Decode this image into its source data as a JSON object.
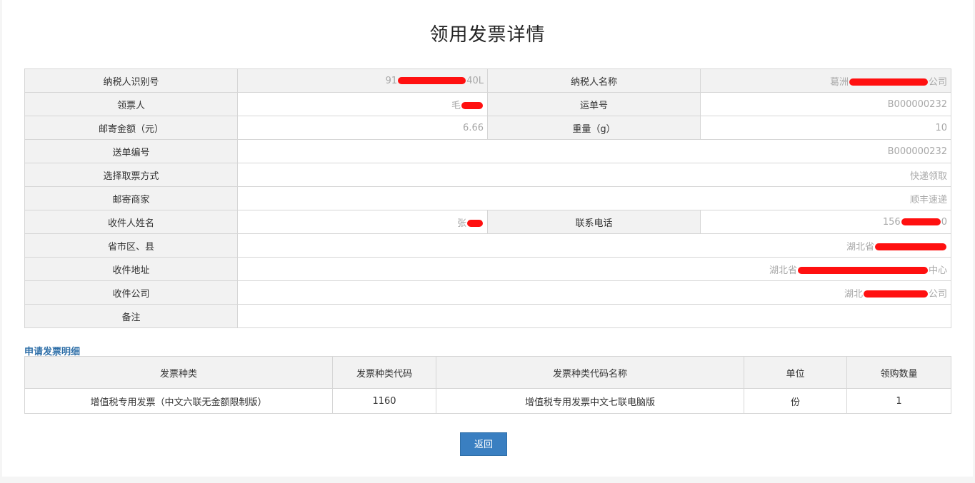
{
  "page": {
    "title": "领用发票详情"
  },
  "detail": {
    "taxpayer_id": {
      "label": "纳税人识别号",
      "value_prefix": "91",
      "value_suffix": "40L"
    },
    "taxpayer_name": {
      "label": "纳税人名称",
      "value_prefix": "葛洲",
      "value_suffix": "公司"
    },
    "recipient": {
      "label": "领票人",
      "value_prefix": "毛",
      "value_suffix": ""
    },
    "waybill_no": {
      "label": "运单号",
      "value": "B000000232"
    },
    "postage": {
      "label": "邮寄金额（元）",
      "value": "6.66"
    },
    "weight": {
      "label": "重量（g）",
      "value": "10"
    },
    "delivery_no": {
      "label": "送单编号",
      "value": "B000000232"
    },
    "pickup_method": {
      "label": "选择取票方式",
      "value": "快递领取"
    },
    "courier": {
      "label": "邮寄商家",
      "value": "顺丰速递"
    },
    "receiver_name": {
      "label": "收件人姓名",
      "value_prefix": "张",
      "value_suffix": ""
    },
    "phone": {
      "label": "联系电话",
      "value_prefix": "156",
      "value_suffix": "0"
    },
    "region": {
      "label": "省市区、县",
      "value_prefix": "湖北省",
      "value_suffix": ""
    },
    "address": {
      "label": "收件地址",
      "value_prefix": "湖北省",
      "value_suffix": "中心"
    },
    "company": {
      "label": "收件公司",
      "value_prefix": "湖北",
      "value_suffix": "公司"
    },
    "remarks": {
      "label": "备注",
      "value": ""
    }
  },
  "items_section": {
    "title": "申请发票明细",
    "headers": [
      "发票种类",
      "发票种类代码",
      "发票种类代码名称",
      "单位",
      "领购数量"
    ],
    "rows": [
      [
        "增值税专用发票（中文六联无金额限制版）",
        "1160",
        "增值税专用发票中文七联电脑版",
        "份",
        "1"
      ]
    ]
  },
  "actions": {
    "back_label": "返回"
  },
  "colors": {
    "button": "#3a7fc1",
    "section_title": "#2f6fa8",
    "redaction": "#ff1010"
  }
}
